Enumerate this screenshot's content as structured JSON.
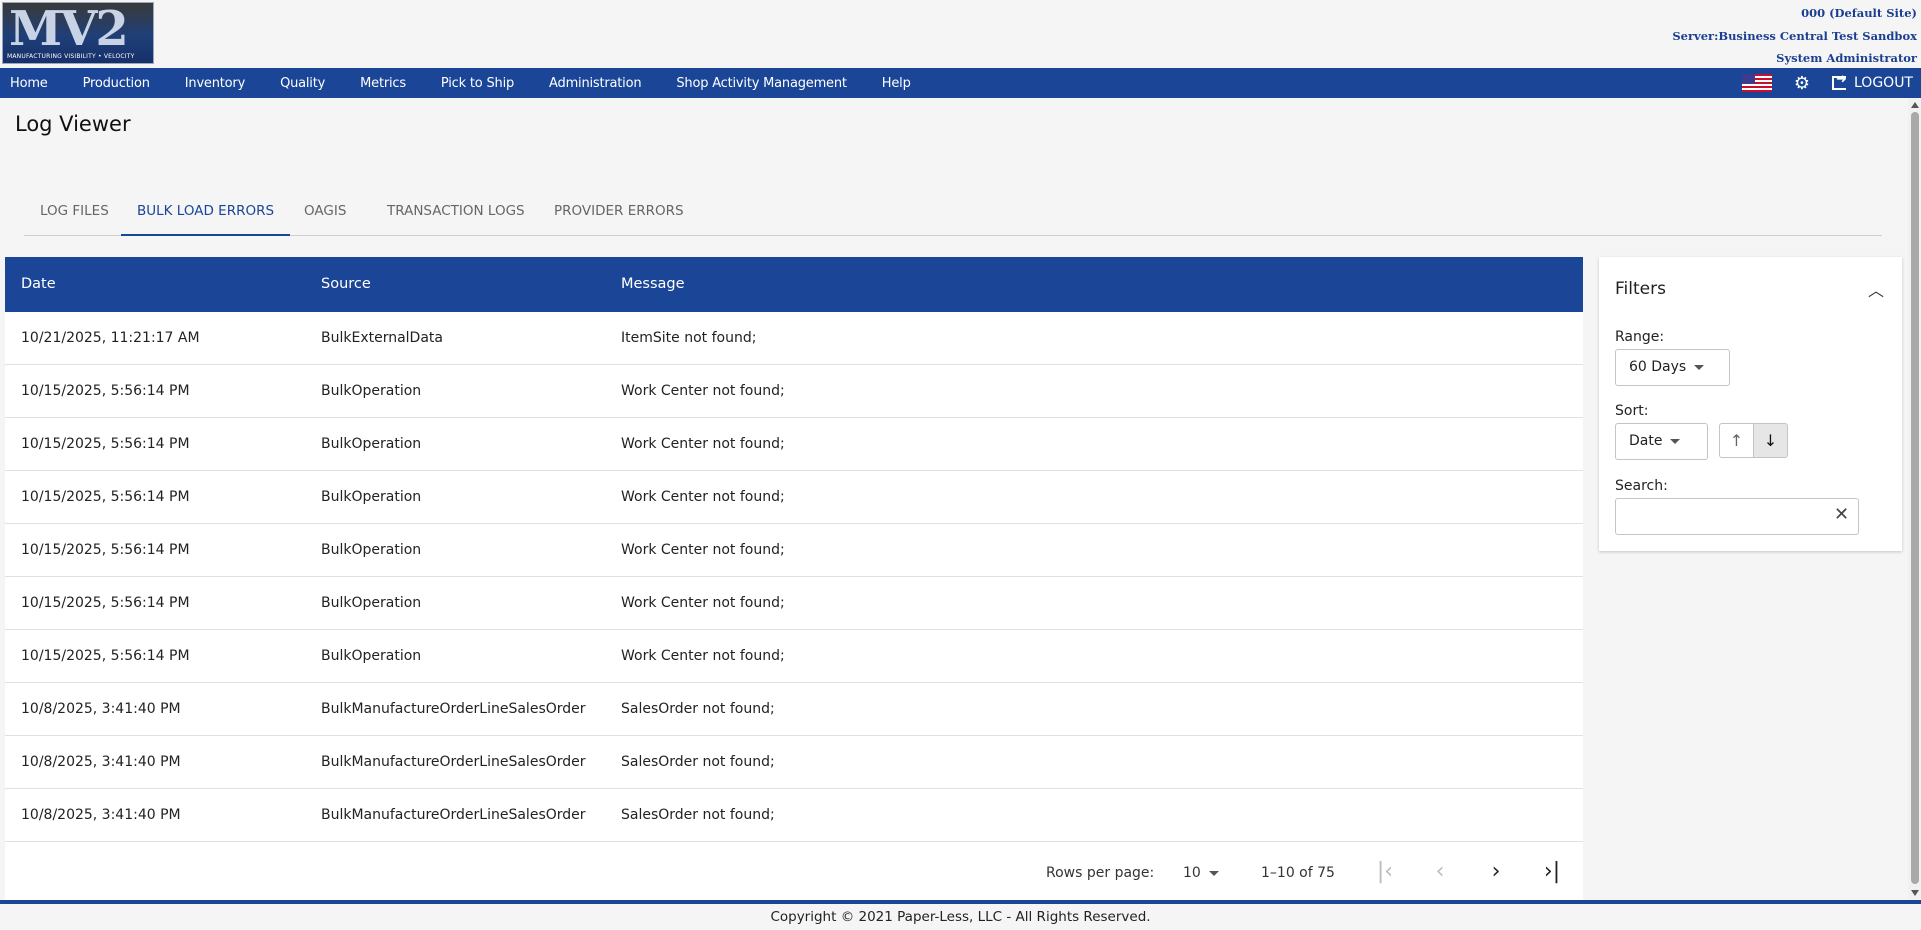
{
  "logo": {
    "mark": "MV2",
    "tagline": "MANUFACTURING VISIBILITY • VELOCITY"
  },
  "site_info": {
    "site": "000 (Default Site)",
    "server": "Server:Business Central Test Sandbox",
    "user": "System Administrator"
  },
  "nav": {
    "items": [
      "Home",
      "Production",
      "Inventory",
      "Quality",
      "Metrics",
      "Pick to Ship",
      "Administration",
      "Shop Activity Management",
      "Help"
    ],
    "logout": "LOGOUT"
  },
  "page": {
    "title": "Log Viewer"
  },
  "tabs": [
    {
      "label": "LOG FILES",
      "active": false
    },
    {
      "label": "BULK LOAD ERRORS",
      "active": true
    },
    {
      "label": "OAGIS",
      "active": false
    },
    {
      "label": "TRANSACTION LOGS",
      "active": false
    },
    {
      "label": "PROVIDER ERRORS",
      "active": false
    }
  ],
  "table": {
    "columns": [
      "Date",
      "Source",
      "Message"
    ],
    "rows": [
      [
        "10/21/2025, 11:21:17 AM",
        "BulkExternalData",
        "ItemSite not found;"
      ],
      [
        "10/15/2025, 5:56:14 PM",
        "BulkOperation",
        "Work Center not found;"
      ],
      [
        "10/15/2025, 5:56:14 PM",
        "BulkOperation",
        "Work Center not found;"
      ],
      [
        "10/15/2025, 5:56:14 PM",
        "BulkOperation",
        "Work Center not found;"
      ],
      [
        "10/15/2025, 5:56:14 PM",
        "BulkOperation",
        "Work Center not found;"
      ],
      [
        "10/15/2025, 5:56:14 PM",
        "BulkOperation",
        "Work Center not found;"
      ],
      [
        "10/15/2025, 5:56:14 PM",
        "BulkOperation",
        "Work Center not found;"
      ],
      [
        "10/8/2025, 3:41:40 PM",
        "BulkManufactureOrderLineSalesOrder",
        "SalesOrder not found;"
      ],
      [
        "10/8/2025, 3:41:40 PM",
        "BulkManufactureOrderLineSalesOrder",
        "SalesOrder not found;"
      ],
      [
        "10/8/2025, 3:41:40 PM",
        "BulkManufactureOrderLineSalesOrder",
        "SalesOrder not found;"
      ]
    ]
  },
  "pagination": {
    "rows_per_page_label": "Rows per page:",
    "rows_per_page": "10",
    "range": "1–10 of 75"
  },
  "filters": {
    "title": "Filters",
    "range_label": "Range:",
    "range_value": "60 Days",
    "sort_label": "Sort:",
    "sort_value": "Date",
    "sort_direction": "descending",
    "search_label": "Search:",
    "search_value": ""
  },
  "footer": {
    "copyright": "Copyright © 2021 Paper-Less, LLC - All Rights Reserved."
  },
  "colors": {
    "brand": "#1b4597",
    "site_text": "#1a3f91"
  }
}
